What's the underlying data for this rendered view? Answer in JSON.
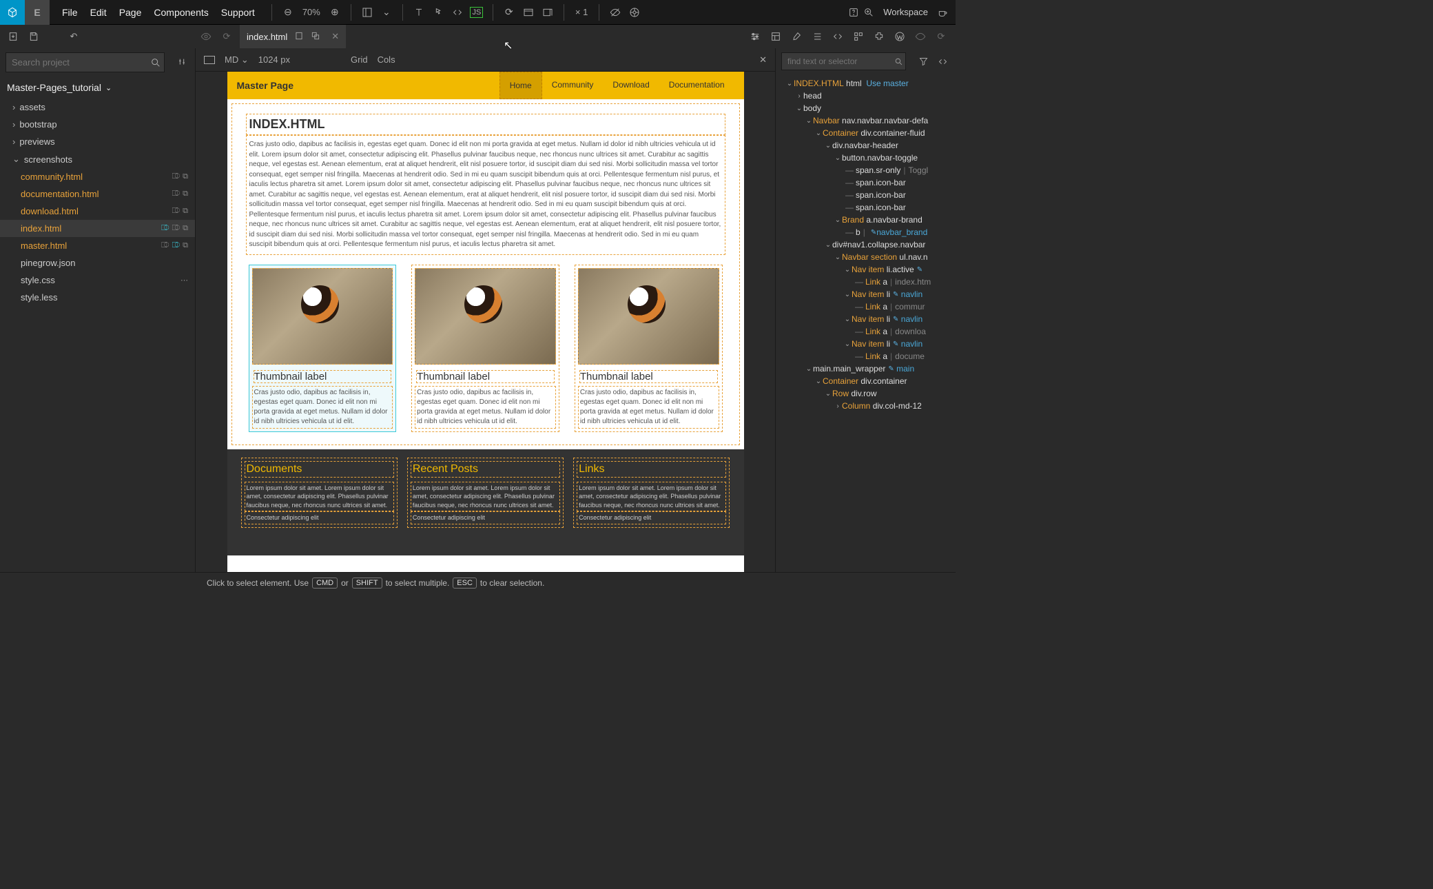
{
  "menu": {
    "file": "File",
    "edit": "Edit",
    "page": "Page",
    "components": "Components",
    "support": "Support"
  },
  "zoom": "70%",
  "multiplier": "× 1",
  "workspace": "Workspace",
  "tab": {
    "name": "index.html"
  },
  "search_placeholder": "Search project",
  "project_name": "Master-Pages_tutorial",
  "tree": {
    "assets": "assets",
    "bootstrap": "bootstrap",
    "previews": "previews",
    "screenshots": "screenshots",
    "community": "community.html",
    "documentation": "documentation.html",
    "download": "download.html",
    "index": "index.html",
    "master": "master.html",
    "pinegrow": "pinegrow.json",
    "stylecss": "style.css",
    "styleless": "style.less"
  },
  "canvas": {
    "breakpoint": "MD",
    "width": "1024 px",
    "grid": "Grid",
    "cols": "Cols"
  },
  "preview": {
    "brand": "Master Page",
    "nav": {
      "home": "Home",
      "community": "Community",
      "download": "Download",
      "documentation": "Documentation"
    },
    "h1": "INDEX.HTML",
    "para": "Cras justo odio, dapibus ac facilisis in, egestas eget quam. Donec id elit non mi porta gravida at eget metus. Nullam id dolor id nibh ultricies vehicula ut id elit. Lorem ipsum dolor sit amet, consectetur adipiscing elit. Phasellus pulvinar faucibus neque, nec rhoncus nunc ultrices sit amet. Curabitur ac sagittis neque, vel egestas est. Aenean elementum, erat at aliquet hendrerit, elit nisl posuere tortor, id suscipit diam dui sed nisi. Morbi sollicitudin massa vel tortor consequat, eget semper nisl fringilla. Maecenas at hendrerit odio. Sed in mi eu quam suscipit bibendum quis at orci. Pellentesque fermentum nisl purus, et iaculis lectus pharetra sit amet. Lorem ipsum dolor sit amet, consectetur adipiscing elit. Phasellus pulvinar faucibus neque, nec rhoncus nunc ultrices sit amet. Curabitur ac sagittis neque, vel egestas est. Aenean elementum, erat at aliquet hendrerit, elit nisl posuere tortor, id suscipit diam dui sed nisi. Morbi sollicitudin massa vel tortor consequat, eget semper nisl fringilla. Maecenas at hendrerit odio. Sed in mi eu quam suscipit bibendum quis at orci. Pellentesque fermentum nisl purus, et iaculis lectus pharetra sit amet. Lorem ipsum dolor sit amet, consectetur adipiscing elit. Phasellus pulvinar faucibus neque, nec rhoncus nunc ultrices sit amet. Curabitur ac sagittis neque, vel egestas est. Aenean elementum, erat at aliquet hendrerit, elit nisl posuere tortor, id suscipit diam dui sed nisi. Morbi sollicitudin massa vel tortor consequat, eget semper nisl fringilla. Maecenas at hendrerit odio. Sed in mi eu quam suscipit bibendum quis at orci. Pellentesque fermentum nisl purus, et iaculis lectus pharetra sit amet.",
    "thumb_label": "Thumbnail label",
    "thumb_text": "Cras justo odio, dapibus ac facilisis in, egestas eget quam. Donec id elit non mi porta gravida at eget metus. Nullam id dolor id nibh ultricies vehicula ut id elit.",
    "footer": {
      "documents": "Documents",
      "recent": "Recent Posts",
      "links": "Links",
      "ftext": "Lorem ipsum dolor sit amet. Lorem ipsum dolor sit amet, consectetur adipiscing elit. Phasellus pulvinar faucibus neque, nec rhoncus nunc ultrices sit amet.",
      "consectetur": "Consectetur adipiscing elit"
    }
  },
  "rp_search_placeholder": "find text or selector",
  "dom": {
    "indexhtml": "INDEX.HTML",
    "html": "html",
    "usemaster": "Use master",
    "head": "head",
    "body": "body",
    "navbar": "Navbar",
    "navbarsel": "nav.navbar.navbar-defa",
    "container": "Container",
    "containersel": "div.container-fluid",
    "navbarheader": "div.navbar-header",
    "navtoggle": "button.navbar-toggle",
    "sronly": "span.sr-only",
    "toggle": "Toggl",
    "iconbar": "span.icon-bar",
    "brand": "Brand",
    "brandsel": "a.navbar-brand",
    "b": "b",
    "navbar_brand": "navbar_brand",
    "collapse": "div#nav1.collapse.navbar",
    "navbarsection": "Navbar section",
    "navbarsectionsel": "ul.nav.n",
    "navitem": "Nav item",
    "liactive": "li.active",
    "li": "li",
    "link": "Link",
    "a": "a",
    "indexhtm": "index.htm",
    "commur": "commur",
    "downloa": "downloa",
    "docume": "docume",
    "navli": "navlin",
    "main": "main.main_wrapper",
    "mainlbl": "main",
    "container2": "Container",
    "container2sel": "div.container",
    "row": "Row",
    "rowsel": "div.row",
    "column": "Column",
    "columnsel": "div.col-md-12"
  },
  "status": {
    "pre": "Click to select element. Use",
    "cmd": "CMD",
    "or": "or",
    "shift": "SHIFT",
    "mid": "to select multiple.",
    "esc": "ESC",
    "post": "to clear selection."
  }
}
